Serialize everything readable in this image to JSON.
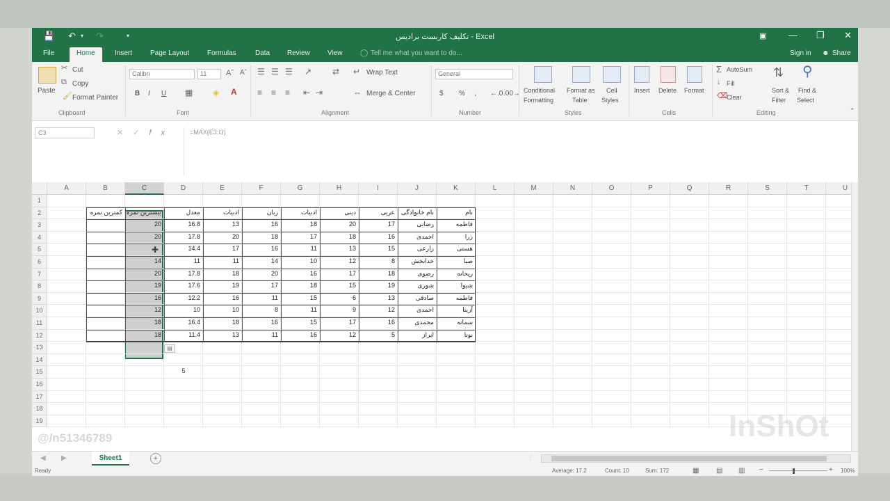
{
  "window": {
    "title": "تکلیف کاربست برادیس - Excel"
  },
  "tabs": {
    "file": "File",
    "home": "Home",
    "insert": "Insert",
    "page_layout": "Page Layout",
    "formulas": "Formulas",
    "data": "Data",
    "review": "Review",
    "view": "View",
    "tell_me": "Tell me what you want to do...",
    "sign_in": "Sign in",
    "share": "Share"
  },
  "ribbon": {
    "clipboard": {
      "paste": "Paste",
      "cut": "Cut",
      "copy": "Copy",
      "format_painter": "Format Painter",
      "group": "Clipboard"
    },
    "font": {
      "name": "Calibri",
      "size": "11",
      "group": "Font",
      "bold": "B",
      "italic": "I",
      "underline": "U"
    },
    "alignment": {
      "wrap_text": "Wrap Text",
      "merge_center": "Merge & Center",
      "group": "Alignment"
    },
    "number": {
      "format": "General",
      "currency": "$",
      "percent": "%",
      "comma": ",",
      "group": "Number"
    },
    "styles": {
      "conditional": "Conditional",
      "formatting": "Formatting",
      "format_as": "Format as",
      "table": "Table",
      "cell": "Cell",
      "styles": "Styles",
      "group": "Styles"
    },
    "cells": {
      "insert": "Insert",
      "delete": "Delete",
      "format": "Format",
      "group": "Cells"
    },
    "editing": {
      "autosum": "AutoSum",
      "fill": "Fill",
      "clear": "Clear",
      "sort": "Sort &",
      "filter": "Filter",
      "find": "Find &",
      "select": "Select",
      "group": "Editing"
    }
  },
  "formula_bar": {
    "name_box": "C3",
    "cancel": "✕",
    "enter": "✓",
    "fx": "fx",
    "formula": "=MAX(E3:I3)"
  },
  "columns": [
    "A",
    "B",
    "C",
    "D",
    "E",
    "F",
    "G",
    "H",
    "I",
    "J",
    "K",
    "L",
    "M",
    "N",
    "O",
    "P",
    "Q",
    "R",
    "S",
    "T",
    "U"
  ],
  "rows": [
    "1",
    "2",
    "3",
    "4",
    "5",
    "6",
    "7",
    "8",
    "9",
    "10",
    "11",
    "12",
    "13",
    "14",
    "15",
    "16",
    "17",
    "18",
    "19"
  ],
  "headers": {
    "B": "کمترین نمره",
    "C": "بیشترین نمره",
    "D": "معدل",
    "E": "ادبیات",
    "F": "زبان",
    "G": "ادبیات",
    "H": "دینی",
    "I": "عربی",
    "J": "نام خانوادگی",
    "K": "نام"
  },
  "table": [
    {
      "C": "20",
      "D": "16.8",
      "E": "13",
      "F": "16",
      "G": "18",
      "H": "20",
      "I": "17",
      "J": "رضایی",
      "K": "فاطمه"
    },
    {
      "C": "20",
      "D": "17.8",
      "E": "20",
      "F": "18",
      "G": "17",
      "H": "18",
      "I": "16",
      "J": "احمدی",
      "K": "زرا"
    },
    {
      "C": "",
      "D": "14.4",
      "E": "17",
      "F": "16",
      "G": "11",
      "H": "13",
      "I": "15",
      "J": "زارعی",
      "K": "هستی"
    },
    {
      "C": "14",
      "D": "11",
      "E": "11",
      "F": "14",
      "G": "10",
      "H": "12",
      "I": "8",
      "J": "خدابخش",
      "K": "صبا"
    },
    {
      "C": "20",
      "D": "17.8",
      "E": "18",
      "F": "20",
      "G": "16",
      "H": "17",
      "I": "18",
      "J": "رضوی",
      "K": "ریحانه"
    },
    {
      "C": "19",
      "D": "17.6",
      "E": "19",
      "F": "17",
      "G": "18",
      "H": "15",
      "I": "19",
      "J": "شوری",
      "K": "شیوا"
    },
    {
      "C": "16",
      "D": "12.2",
      "E": "16",
      "F": "11",
      "G": "15",
      "H": "6",
      "I": "13",
      "J": "صادقی",
      "K": "فاطمه"
    },
    {
      "C": "12",
      "D": "10",
      "E": "10",
      "F": "8",
      "G": "11",
      "H": "9",
      "I": "12",
      "J": "احمدی",
      "K": "آزیتا"
    },
    {
      "C": "18",
      "D": "16.4",
      "E": "18",
      "F": "16",
      "G": "15",
      "H": "17",
      "I": "16",
      "J": "محمدی",
      "K": "سمانه"
    },
    {
      "C": "18",
      "D": "11.4",
      "E": "13",
      "F": "11",
      "G": "16",
      "H": "12",
      "I": "5",
      "J": "ابراز",
      "K": "نونا"
    }
  ],
  "extra_cell": {
    "D15": "5"
  },
  "sheet": {
    "tab": "Sheet1",
    "add": "+"
  },
  "status": {
    "ready": "Ready",
    "average": "Average: 17.2",
    "count": "Count: 10",
    "sum": "Sum: 172",
    "zoom": "100%"
  },
  "watermark": {
    "handle": "@/n51346789",
    "brand": "InShOt"
  }
}
